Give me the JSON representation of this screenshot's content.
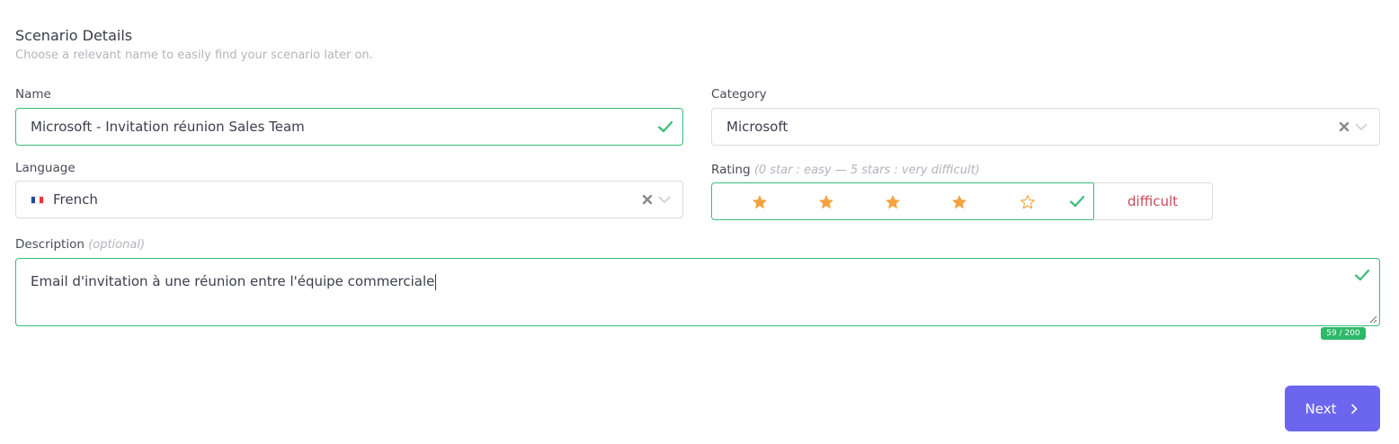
{
  "header": {
    "title": "Scenario Details",
    "subtitle": "Choose a relevant name to easily find your scenario later on."
  },
  "name_field": {
    "label": "Name",
    "value": "Microsoft - Invitation réunion Sales Team",
    "valid": true
  },
  "category_field": {
    "label": "Category",
    "value": "Microsoft"
  },
  "language_field": {
    "label": "Language",
    "value": "French",
    "flag_colors": [
      "#1f4aa8",
      "#ffffff",
      "#e03a3e"
    ]
  },
  "rating_field": {
    "label": "Rating",
    "hint": "(0 star : easy — 5 stars : very difficult)",
    "value": 4,
    "max": 5,
    "level_text": "difficult"
  },
  "description_field": {
    "label": "Description",
    "hint": "(optional)",
    "value": "Email d'invitation à une réunion entre l'équipe commerciale",
    "counter": "59 / 200"
  },
  "actions": {
    "next_label": "Next"
  },
  "colors": {
    "valid": "#3cbd78",
    "star": "#f4a340",
    "accent": "#6c66ee",
    "danger_text": "#c94a5a",
    "counter_bg": "#2fb86a"
  }
}
